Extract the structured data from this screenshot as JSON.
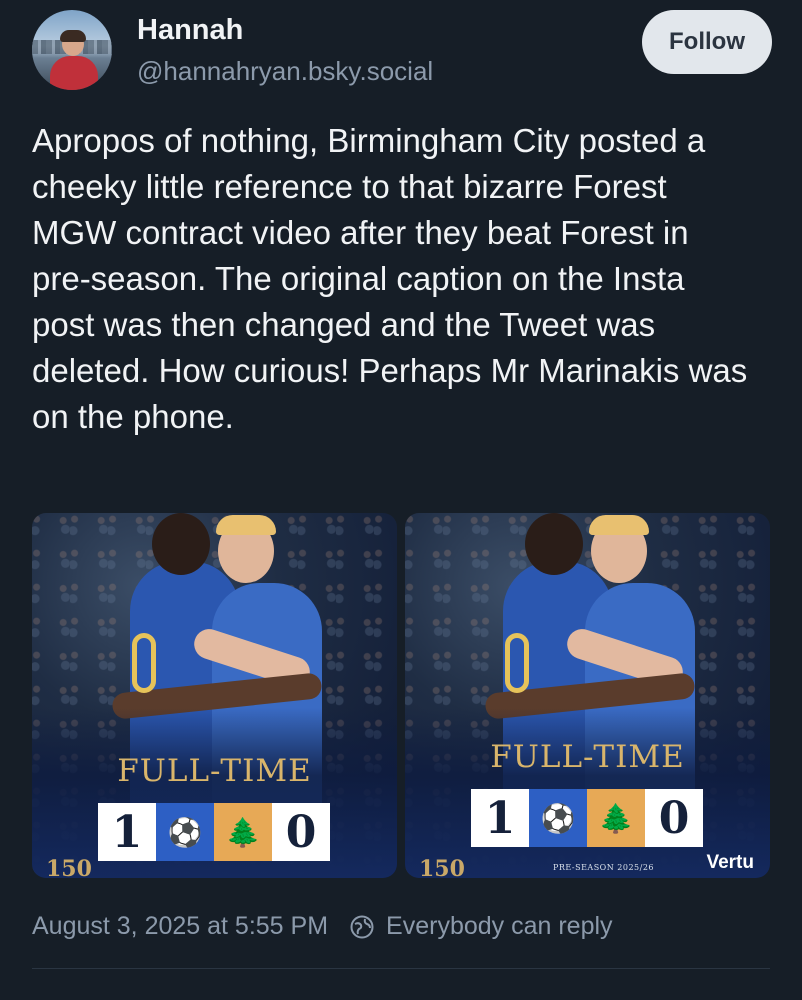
{
  "author": {
    "name": "Hannah",
    "handle": "@hannahryan.bsky.social"
  },
  "follow_label": "Follow",
  "post_text": "Apropos of nothing, Birmingham City posted a cheeky little reference to that bizarre Forest MGW contract video after they beat Forest in pre-season. The original caption on the Insta post was then changed and the Tweet was deleted. How curious! Perhaps Mr Marinakis was on the phone.",
  "images": [
    {
      "fulltime_label": "FULL-TIME",
      "home_score": "1",
      "away_score": "0",
      "home_crest": "birmingham-city-crest",
      "away_crest": "nottingham-forest-crest",
      "corner_text": "150"
    },
    {
      "fulltime_label": "FULL-TIME",
      "home_score": "1",
      "away_score": "0",
      "home_crest": "birmingham-city-crest",
      "away_crest": "nottingham-forest-crest",
      "corner_text": "150",
      "footer_text": "PRE-SEASON 2025/26",
      "sponsor": "Vertu"
    }
  ],
  "footer": {
    "timestamp": "August 3, 2025 at 5:55 PM",
    "reply_setting": "Everybody can reply",
    "reply_icon": "globe-reply-icon"
  },
  "colors": {
    "background": "#161e27",
    "text": "#f1f3f5",
    "muted": "#8c9aab",
    "follow_bg": "#e2e7ec",
    "fulltime_gold": "#d9b56b"
  }
}
